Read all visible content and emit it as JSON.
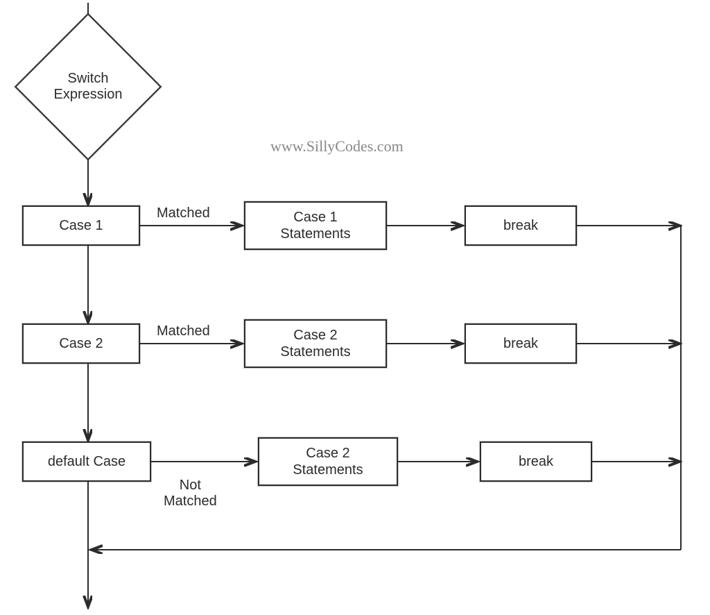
{
  "watermark": "www.SillyCodes.com",
  "nodes": {
    "switch_expression": "Switch\nExpression",
    "case1": "Case 1",
    "case1_stmts": "Case 1\nStatements",
    "case1_break": "break",
    "case2": "Case 2",
    "case2_stmts": "Case 2\nStatements",
    "case2_break": "break",
    "default_case": "default Case",
    "default_stmts": "Case 2\nStatements",
    "default_break": "break"
  },
  "edges": {
    "case1_matched": "Matched",
    "case2_matched": "Matched",
    "default_not_matched": "Not\nMatched"
  }
}
